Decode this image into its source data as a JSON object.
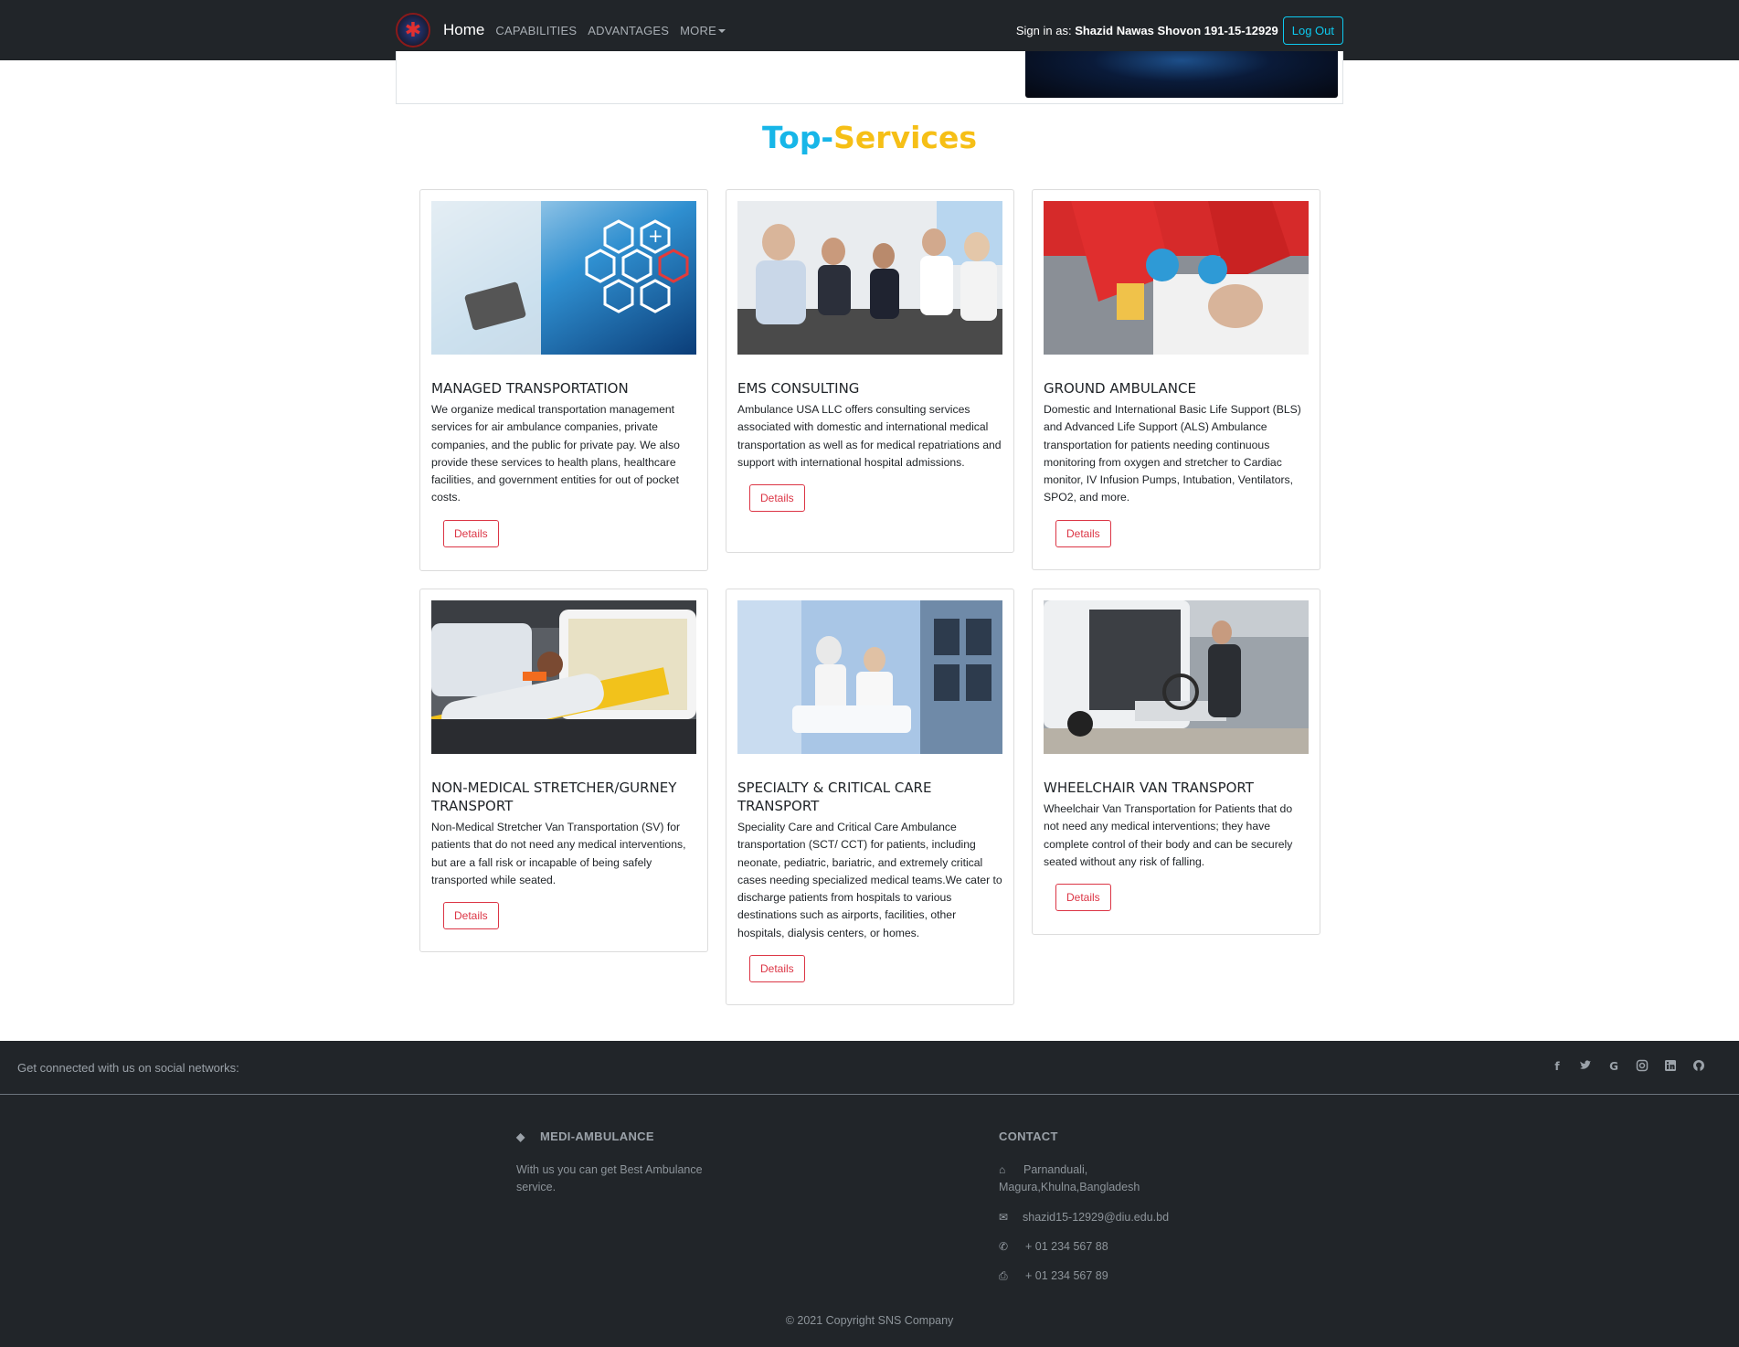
{
  "navbar": {
    "brand": "Home",
    "links": [
      "CAPABILITIES",
      "ADVANTAGES",
      "MORE"
    ],
    "signin_prefix": "Sign in as: ",
    "signin_user": "Shazid Nawas Shovon 191-15-12929",
    "logout_label": "Log Out"
  },
  "section": {
    "title_part1": "Top-",
    "title_part2": "Services"
  },
  "cards": [
    {
      "title": "MANAGED TRANSPORTATION",
      "text": "We organize medical transportation management services for air ambulance companies, private companies, and the public for private pay. We also provide these services to health plans, healthcare facilities, and government entities for out of pocket costs.",
      "button": "Details"
    },
    {
      "title": "EMS CONSULTING",
      "text": "Ambulance USA LLC offers consulting services associated with domestic and international medical transportation as well as for medical repatriations and support with international hospital admissions.",
      "button": "Details"
    },
    {
      "title": "GROUND AMBULANCE",
      "text": "Domestic and International Basic Life Support (BLS) and Advanced Life Support (ALS) Ambulance transportation for patients needing continuous monitoring from oxygen and stretcher to Cardiac monitor, IV Infusion Pumps, Intubation, Ventilators, SPO2, and more.",
      "button": "Details"
    },
    {
      "title": "NON-MEDICAL STRETCHER/GURNEY TRANSPORT",
      "text": "Non-Medical Stretcher Van Transportation (SV) for patients that do not need any medical interventions, but are a fall risk or incapable of being safely transported while seated.",
      "button": "Details"
    },
    {
      "title": "SPECIALTY & CRITICAL CARE TRANSPORT",
      "text": "Speciality Care and Critical Care Ambulance transportation (SCT/ CCT) for patients, including neonate, pediatric, bariatric, and extremely critical cases needing specialized medical teams.We cater to discharge patients from hospitals to various destinations such as airports, facilities, other hospitals, dialysis centers, or homes.",
      "button": "Details"
    },
    {
      "title": "WHEELCHAIR VAN TRANSPORT",
      "text": "Wheelchair Van Transportation for Patients that do not need any medical interventions; they have complete control of their body and can be securely seated without any risk of falling.",
      "button": "Details"
    }
  ],
  "footer": {
    "social_text": "Get connected with us on social networks:",
    "social_icons": [
      "facebook-icon",
      "twitter-icon",
      "google-icon",
      "instagram-icon",
      "linkedin-icon",
      "github-icon"
    ],
    "brand_title": "MEDI-AMBULANCE",
    "brand_text": "With us you can get Best Ambulance service.",
    "contact_title": "CONTACT",
    "address": "Parnanduali, Magura,Khulna,Bangladesh",
    "email": "shazid15-12929@diu.edu.bd",
    "phone": "+ 01 234 567 88",
    "fax": "+ 01 234 567 89",
    "copyright": "© 2021 Copyright SNS Company"
  },
  "colors": {
    "navbar_bg": "#212529",
    "title_blue": "#17b6e8",
    "title_yellow": "#f6bf16",
    "details_red": "#dc3545",
    "logout_cyan": "#0dcaf0"
  }
}
